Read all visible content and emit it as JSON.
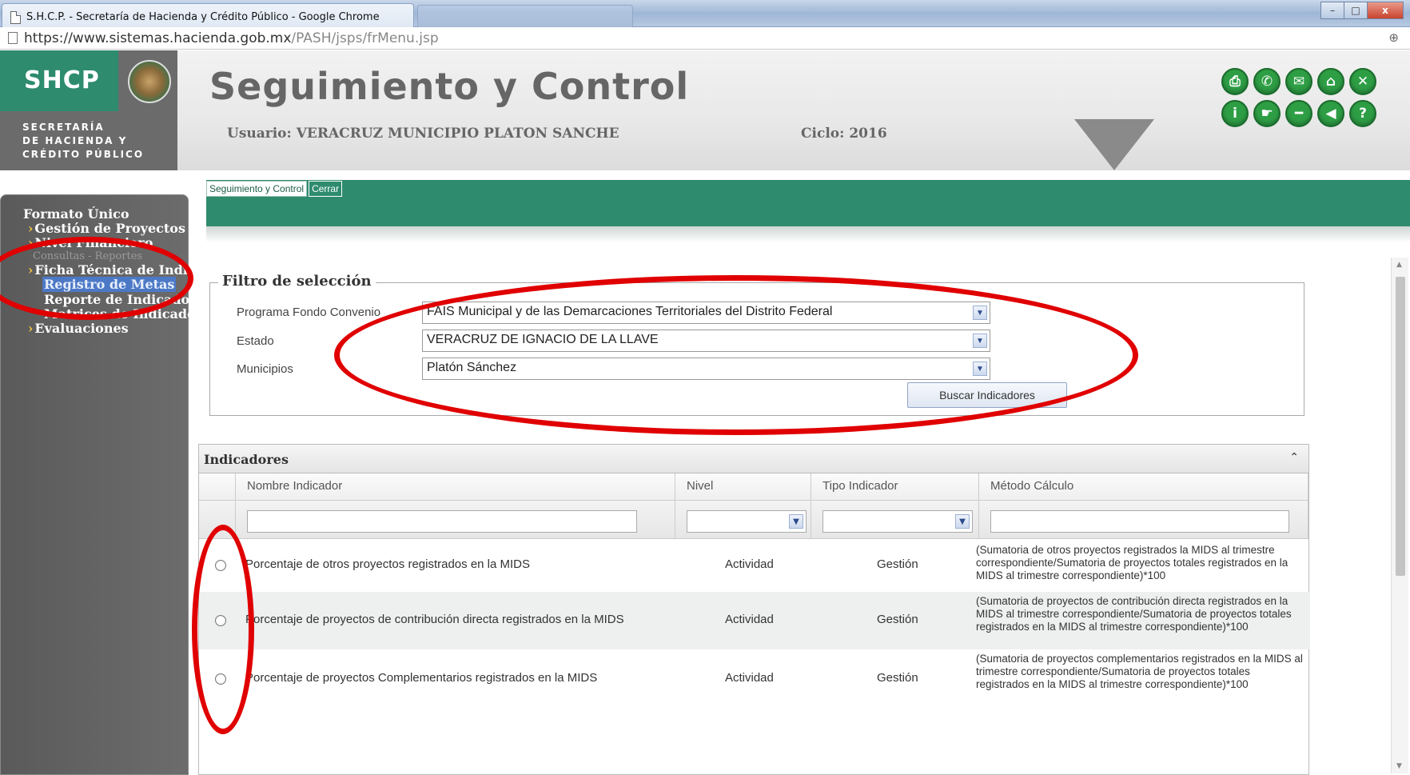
{
  "window": {
    "title": "S.H.C.P. - Secretaría de Hacienda y Crédito Público - Google Chrome",
    "buttons": [
      "–",
      "□",
      "x"
    ]
  },
  "address": {
    "url_base": "https://www.sistemas.hacienda.gob.mx",
    "url_path": "/PASH/jsps/frMenu.jsp",
    "zoom_icon": "⊕"
  },
  "header": {
    "logo_text": "SHCP",
    "logo_sub_1": "SECRETARÍA",
    "logo_sub_2": "DE HACIENDA Y",
    "logo_sub_3": "CRÉDITO PÚBLICO",
    "app_title": "Seguimiento y Control",
    "user_label": "Usuario: VERACRUZ MUNICIPIO PLATON SANCHE",
    "ciclo_label": "Ciclo: 2016",
    "icons": [
      "print-icon",
      "phone-icon",
      "mail-icon",
      "home-icon",
      "close-icon",
      "info-icon",
      "pointer-icon",
      "minus-icon",
      "back-icon",
      "help-icon"
    ]
  },
  "menu": {
    "tabs": [
      "Seguimiento y Control",
      "Cerrar"
    ]
  },
  "sidebar": {
    "items": [
      "Formato Único",
      "Gestión de Proyectos",
      "Nivel Financiero",
      "Consultas - Reportes",
      "Ficha Técnica de Indic",
      "Registro de Metas",
      "Reporte de Indicadore",
      "Matrices de Indicado",
      "Evaluaciones"
    ]
  },
  "filter": {
    "legend": "Filtro de selección",
    "programa_label": "Programa Fondo Convenio",
    "programa_value": "FAIS Municipal y de las Demarcaciones Territoriales del Distrito Federal",
    "estado_label": "Estado",
    "estado_value": "VERACRUZ DE IGNACIO DE LA LLAVE",
    "municipios_label": "Municipios",
    "municipios_value": "Platón Sánchez",
    "buscar_button": "Buscar Indicadores"
  },
  "indicadores": {
    "title": "Indicadores",
    "collapse_icon": "⌃",
    "columns": [
      "Nombre Indicador",
      "Nivel",
      "Tipo Indicador",
      "Método Cálculo"
    ],
    "rows": [
      {
        "nombre": "Porcentaje de otros proyectos registrados en la MIDS",
        "nivel": "Actividad",
        "tipo": "Gestión",
        "metodo": "(Sumatoria de otros proyectos registrados la MIDS al trimestre correspondiente/Sumatoria de proyectos totales registrados en la MIDS al trimestre correspondiente)*100"
      },
      {
        "nombre": "Porcentaje de proyectos de contribución directa registrados en la MIDS",
        "nivel": "Actividad",
        "tipo": "Gestión",
        "metodo": "(Sumatoria de proyectos de contribución directa registrados en la MIDS al trimestre correspondiente/Sumatoria de proyectos totales registrados en la MIDS al trimestre correspondiente)*100"
      },
      {
        "nombre": "Porcentaje de proyectos Complementarios registrados en la MIDS",
        "nivel": "Actividad",
        "tipo": "Gestión",
        "metodo": "(Sumatoria de proyectos complementarios registrados en la MIDS al trimestre correspondiente/Sumatoria de proyectos totales registrados en la MIDS al trimestre correspondiente)*100"
      }
    ]
  },
  "colors": {
    "brand_green": "#2e8b6e",
    "annotation_red": "#e00000",
    "selected_blue": "#4c79c6"
  }
}
